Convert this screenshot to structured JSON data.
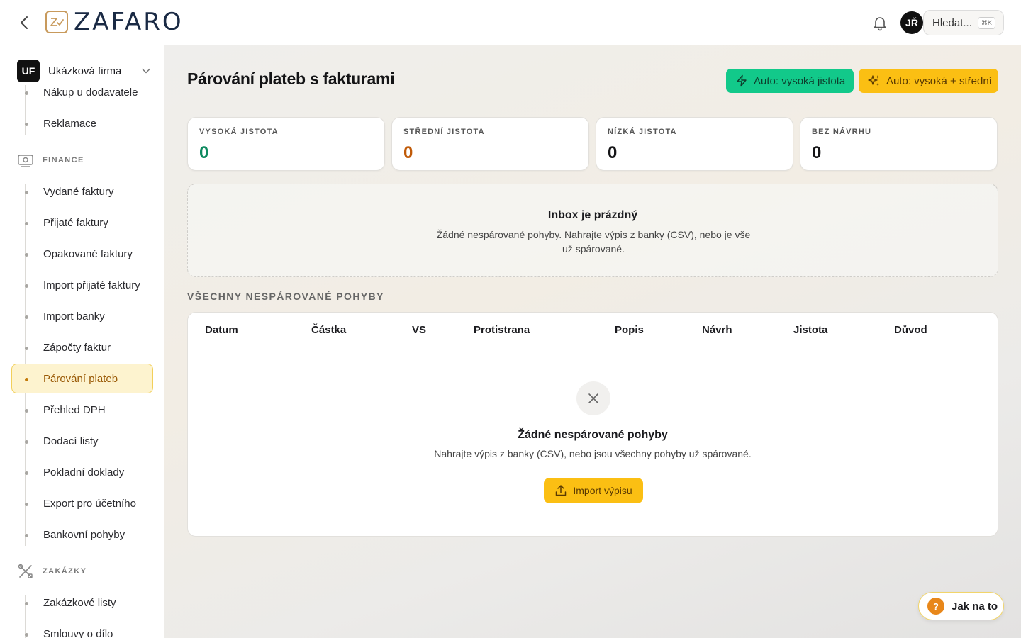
{
  "app": {
    "logo_text": "ZAFARO",
    "user_initials": "JŘ",
    "search_label": "Hledat...",
    "search_shortcut": "⌘K"
  },
  "sidebar": {
    "company_badge": "UF",
    "company_name": "Ukázková firma",
    "items_top": [
      {
        "label": "Nákup u dodavatele"
      },
      {
        "label": "Reklamace"
      }
    ],
    "finance_heading": "FINANCE",
    "finance_items": [
      {
        "label": "Vydané faktury"
      },
      {
        "label": "Přijaté faktury"
      },
      {
        "label": "Opakované faktury"
      },
      {
        "label": "Import přijaté faktury"
      },
      {
        "label": "Import banky"
      },
      {
        "label": "Zápočty faktur"
      },
      {
        "label": "Párování plateb",
        "active": true
      },
      {
        "label": "Přehled DPH"
      },
      {
        "label": "Dodací listy"
      },
      {
        "label": "Pokladní doklady"
      },
      {
        "label": "Export pro účetního"
      },
      {
        "label": "Bankovní pohyby"
      }
    ],
    "zakazky_heading": "ZAKÁZKY",
    "zakazky_items": [
      {
        "label": "Zakázkové listy"
      },
      {
        "label": "Smlouvy o dílo"
      }
    ]
  },
  "main": {
    "title": "Párování plateb s fakturami",
    "btn_auto_high": "Auto: vysoká jistota",
    "btn_auto_mid": "Auto: vysoká + střední",
    "stats": [
      {
        "label": "VYSOKÁ JISTOTA",
        "value": "0",
        "color": "#0e8a5f"
      },
      {
        "label": "STŘEDNÍ JISTOTA",
        "value": "0",
        "color": "#c05a08"
      },
      {
        "label": "NÍZKÁ JISTOTA",
        "value": "0",
        "color": "#141416"
      },
      {
        "label": "BEZ NÁVRHU",
        "value": "0",
        "color": "#141416"
      }
    ],
    "inbox_title": "Inbox je prázdný",
    "inbox_text": "Žádné nespárované pohyby. Nahrajte výpis z banky (CSV), nebo je vše už spárované.",
    "section_label": "VŠECHNY NESPÁROVANÉ POHYBY",
    "table": {
      "columns": [
        "Datum",
        "Částka",
        "VS",
        "Protistrana",
        "Popis",
        "Návrh",
        "Jistota",
        "Důvod"
      ],
      "empty_title": "Žádné nespárované pohyby",
      "empty_text": "Nahrajte výpis z banky (CSV), nebo jsou všechny pohyby už spárované.",
      "import_label": "Import výpisu"
    }
  },
  "help": {
    "label": "Jak na to",
    "icon_char": "?"
  }
}
